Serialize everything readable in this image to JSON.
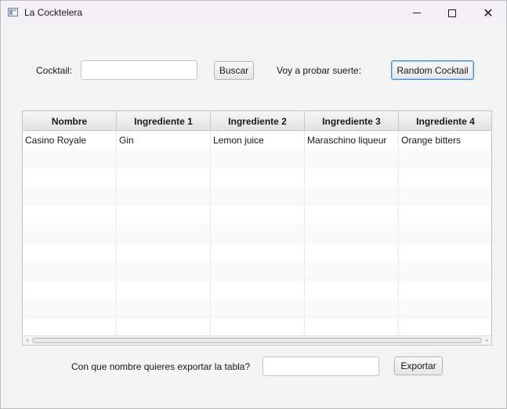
{
  "window": {
    "title": "La Cocktelera",
    "icon": "app-window-icon",
    "controls": [
      "minimize-icon",
      "maximize-icon",
      "close-icon"
    ]
  },
  "search": {
    "cocktail_label": "Cocktail:",
    "cocktail_value": "",
    "search_button": "Buscar",
    "luck_label": "Voy a probar suerte:",
    "random_button": "Random Cocktail"
  },
  "table": {
    "columns": [
      "Nombre",
      "Ingrediente 1",
      "Ingrediente 2",
      "Ingrediente 3",
      "Ingrediente 4"
    ],
    "rows": [
      [
        "Casino Royale",
        "Gin",
        "Lemon juice",
        "Maraschino liqueur",
        "Orange bitters"
      ]
    ]
  },
  "export": {
    "label": "Con que nombre quieres exportar la tabla?",
    "filename_value": "",
    "button": "Exportar"
  },
  "colors": {
    "accent_focus": "#3c8fd8",
    "titlebar": "#f3f0f8",
    "background": "#f3f3f3"
  }
}
